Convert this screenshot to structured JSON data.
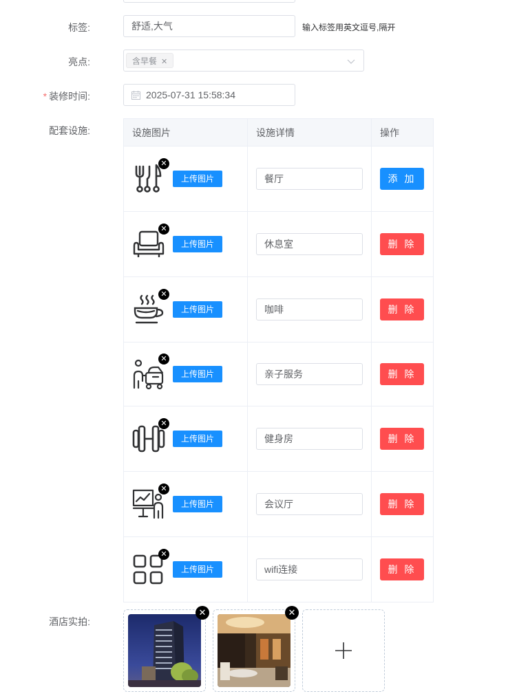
{
  "form": {
    "tags_label": "标签:",
    "tags_value": "舒适,大气",
    "tags_hint": "输入标签用英文逗号,隔开",
    "highlights_label": "亮点:",
    "highlights_tags": [
      "含早餐"
    ],
    "renovation_label": "装修时间:",
    "renovation_required": "*",
    "renovation_value": "2025-07-31 15:58:34",
    "facilities_label": "配套设施:",
    "photos_label": "酒店实拍:"
  },
  "table": {
    "headers": [
      "设施图片",
      "设施详情",
      "操作"
    ],
    "upload_label": "上传图片",
    "rows": [
      {
        "icon": "restaurant-icon",
        "detail": "餐厅",
        "action": "添 加",
        "action_type": "add"
      },
      {
        "icon": "armchair-icon",
        "detail": "休息室",
        "action": "删 除",
        "action_type": "delete"
      },
      {
        "icon": "coffee-icon",
        "detail": "咖啡",
        "action": "删 除",
        "action_type": "delete"
      },
      {
        "icon": "family-icon",
        "detail": "亲子服务",
        "action": "删 除",
        "action_type": "delete"
      },
      {
        "icon": "dumbbell-icon",
        "detail": "健身房",
        "action": "删 除",
        "action_type": "delete"
      },
      {
        "icon": "meeting-icon",
        "detail": "会议厅",
        "action": "删 除",
        "action_type": "delete"
      },
      {
        "icon": "grid-icon",
        "detail": "wifi连接",
        "action": "删 除",
        "action_type": "delete"
      }
    ]
  },
  "colors": {
    "primary": "#1890ff",
    "danger": "#ff4d4f",
    "required": "#f56c6c"
  }
}
